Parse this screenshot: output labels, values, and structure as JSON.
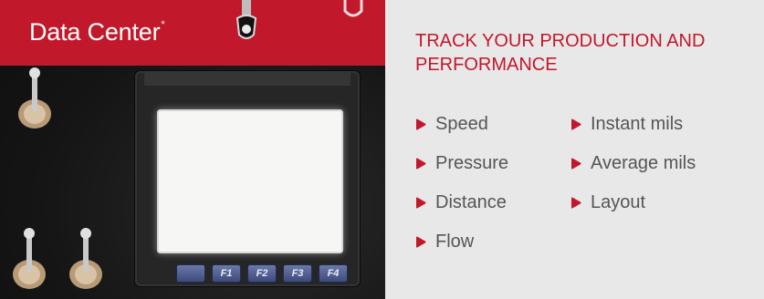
{
  "header": {
    "title": "Data Center",
    "title_mark": "*"
  },
  "device": {
    "keys": [
      "",
      "F1",
      "F2",
      "F3",
      "F4"
    ]
  },
  "content": {
    "heading": "TRACK YOUR PRODUCTION AND PERFORMANCE",
    "features_col1": [
      "Speed",
      "Pressure",
      "Distance",
      "Flow"
    ],
    "features_col2": [
      "Instant mils",
      "Average mils",
      "Layout"
    ]
  },
  "colors": {
    "accent": "#c2182b",
    "text": "#555555",
    "background": "#e8e8e8"
  }
}
